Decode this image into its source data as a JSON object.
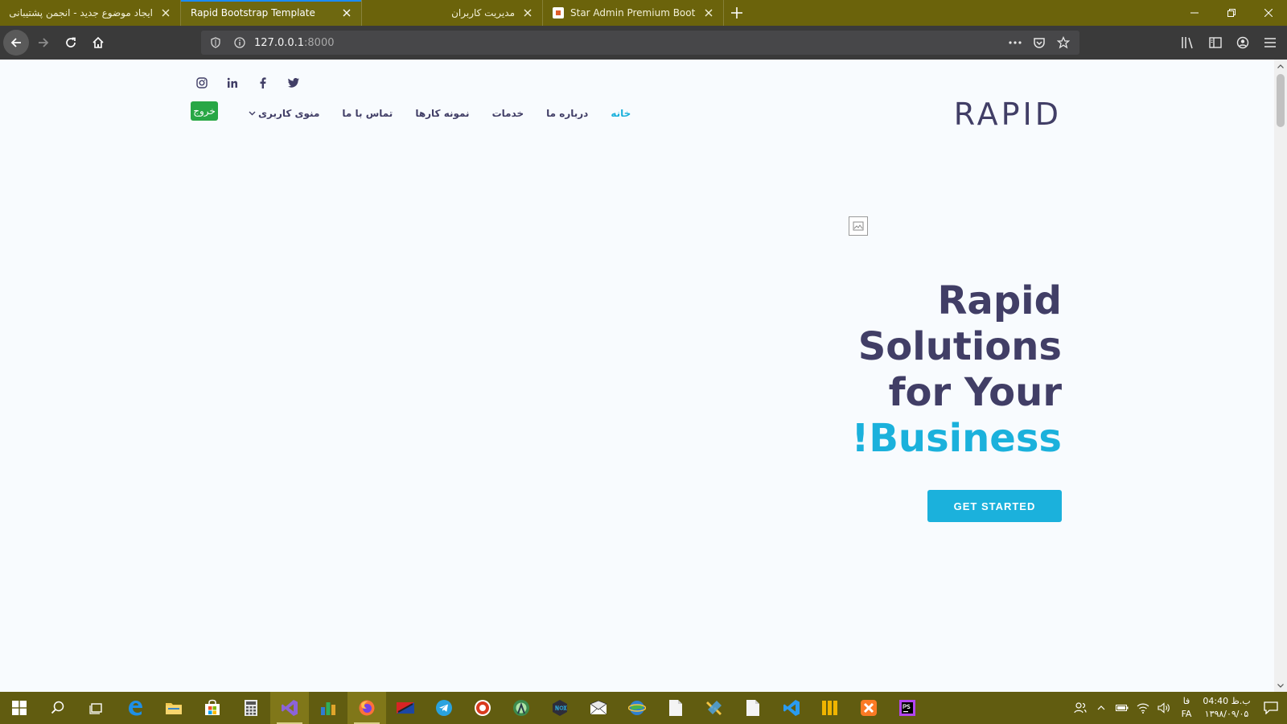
{
  "browser": {
    "tabs": [
      {
        "title": "ایجاد موضوع جدید - انجمن پشتیبانی ل",
        "rtl": true,
        "active": false
      },
      {
        "title": "Rapid Bootstrap Template",
        "rtl": false,
        "active": true
      },
      {
        "title": "مدیریت کاربران",
        "rtl": true,
        "active": false
      },
      {
        "title": "Star Admin Premium Bootstrap",
        "rtl": false,
        "active": false
      }
    ],
    "url_host": "127.0.0.1",
    "url_port": ":8000"
  },
  "page": {
    "brand": "RAPID",
    "social_icons": [
      "instagram-icon",
      "linkedin-icon",
      "facebook-icon",
      "twitter-icon"
    ],
    "logout_label": "خروج",
    "nav": {
      "home": "خانه",
      "about": "درباره ما",
      "services": "خدمات",
      "portfolio": "نمونه کارها",
      "contact": "تماس با ما",
      "user_menu": "منوی کاربری"
    },
    "hero": {
      "line1": "Rapid",
      "line2": "Solutions",
      "line3": "for Your",
      "line4": "!Business",
      "cta": "GET STARTED"
    }
  },
  "taskbar": {
    "lang_top": "فا",
    "lang_bottom": "FA",
    "time": "ب.ظ 04:40",
    "date": "۱۳۹۸/۰۹/۰۵"
  },
  "colors": {
    "accent": "#1bb1dc",
    "text_dark": "#413e66",
    "success": "#28a745",
    "tabstrip": "#6b630b",
    "taskbar": "#615c10"
  }
}
